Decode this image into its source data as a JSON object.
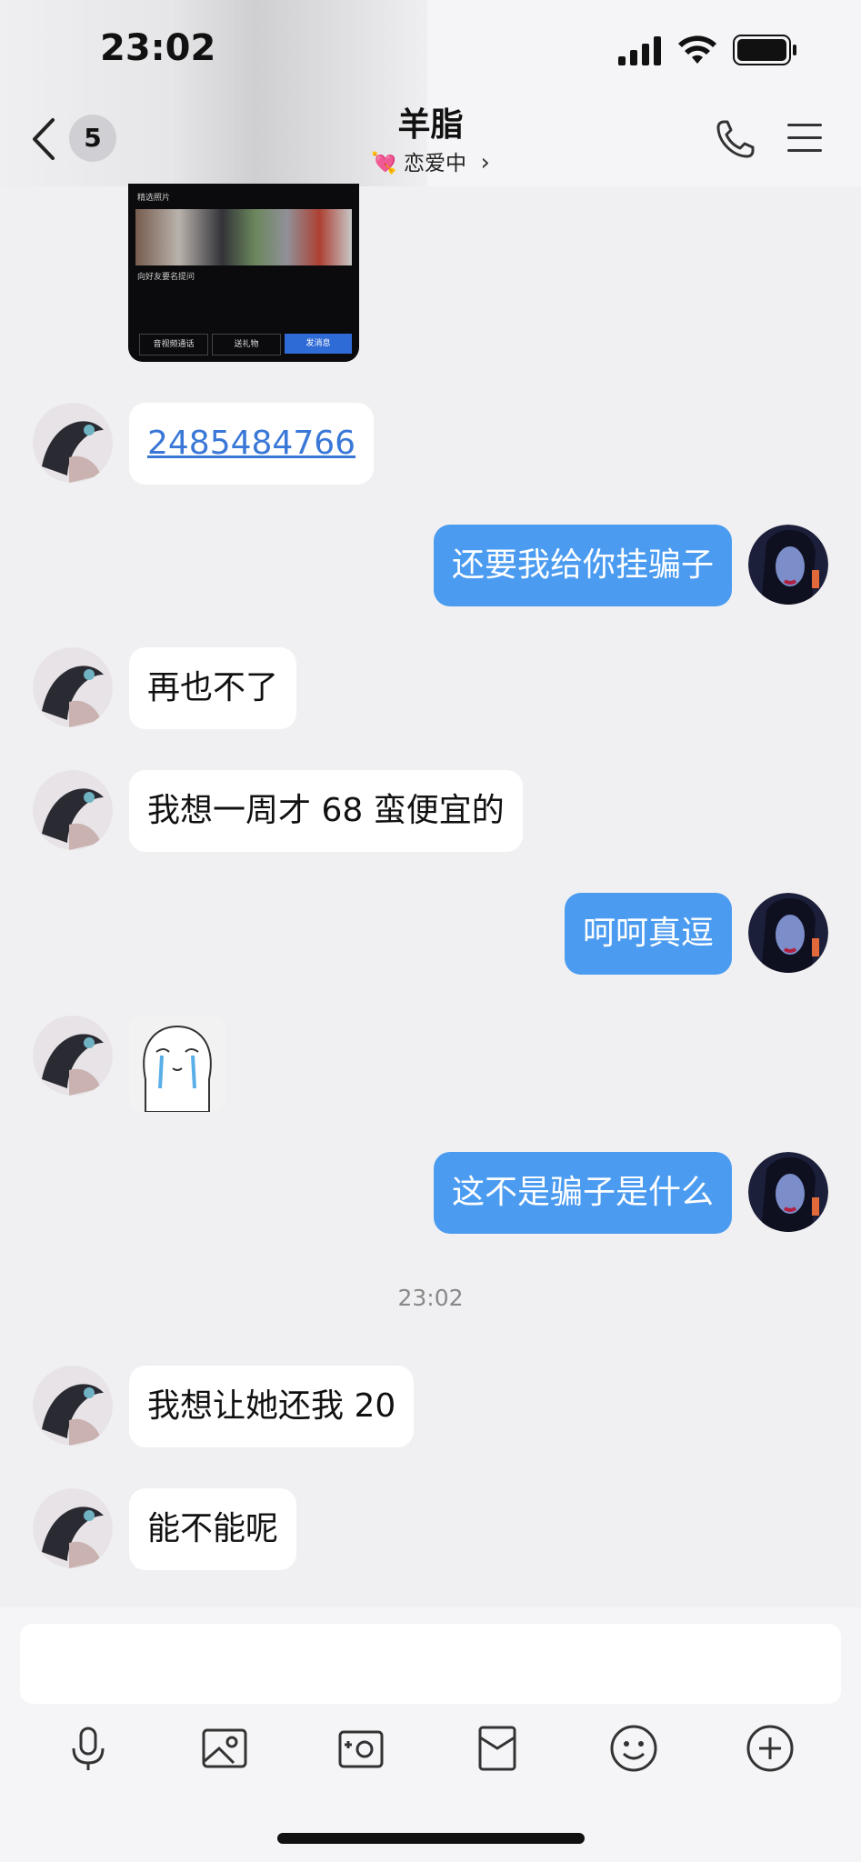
{
  "status_bar": {
    "time": "23:02"
  },
  "header": {
    "unread_count": "5",
    "title": "羊脂",
    "subtitle_emoji": "💘",
    "subtitle": "恋爱中"
  },
  "screenshot_card": {
    "row1": "精选照片",
    "row2": "向好友要名提问",
    "btn1": "音视频通话",
    "btn2": "送礼物",
    "btn3": "发消息"
  },
  "messages": [
    {
      "side": "left",
      "text": "2485484766",
      "type": "link"
    },
    {
      "side": "right",
      "text": "还要我给你挂骗子"
    },
    {
      "side": "left",
      "text": "再也不了"
    },
    {
      "side": "left",
      "text": "我想一周才 68 蛮便宜的"
    },
    {
      "side": "right",
      "text": "呵呵真逗"
    },
    {
      "side": "left",
      "type": "sticker"
    },
    {
      "side": "right",
      "text": "这不是骗子是什么"
    },
    {
      "side": "left",
      "text": "我想让她还我 20"
    },
    {
      "side": "left",
      "text": "能不能呢"
    }
  ],
  "timestamp": "23:02",
  "toolbar_icons": [
    "microphone-icon",
    "image-icon",
    "camera-icon",
    "red-packet-icon",
    "emoji-icon",
    "plus-icon"
  ]
}
